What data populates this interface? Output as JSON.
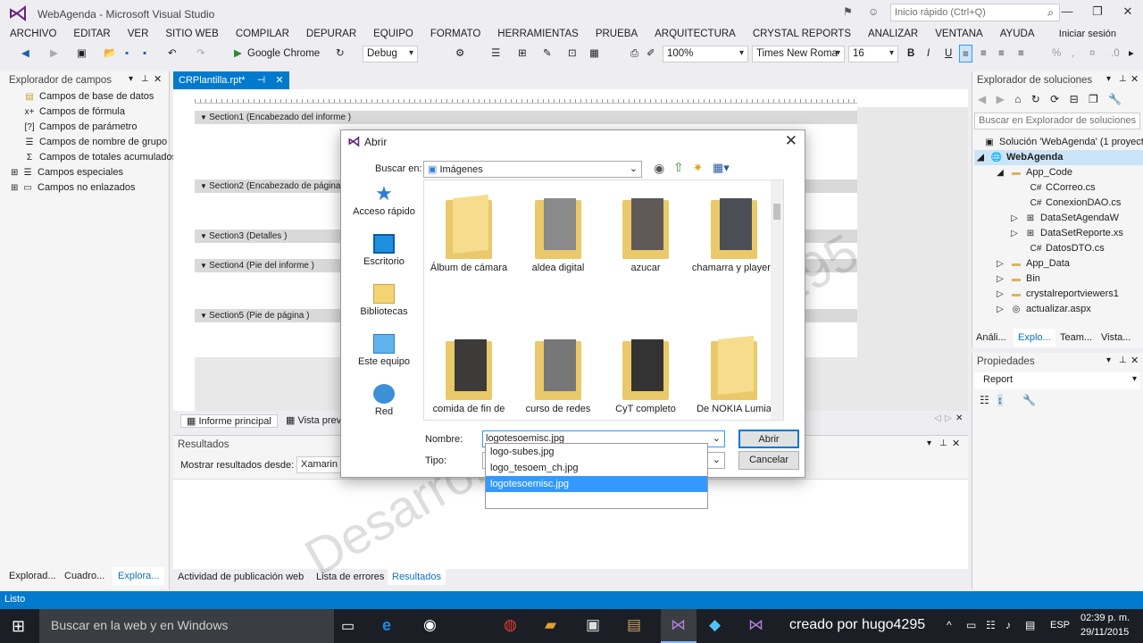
{
  "window": {
    "title": "WebAgenda - Microsoft Visual Studio",
    "quick_launch_placeholder": "Inicio rápido (Ctrl+Q)",
    "signin": "Iniciar sesión"
  },
  "menu": [
    "ARCHIVO",
    "EDITAR",
    "VER",
    "SITIO WEB",
    "COMPILAR",
    "DEPURAR",
    "EQUIPO",
    "FORMATO",
    "HERRAMIENTAS",
    "PRUEBA",
    "ARQUITECTURA",
    "CRYSTAL REPORTS",
    "ANALIZAR",
    "VENTANA",
    "AYUDA"
  ],
  "toolbar": {
    "browser": "Google Chrome",
    "config": "Debug",
    "zoom": "100%",
    "font": "Times New Roma",
    "font_size": "16"
  },
  "field_explorer": {
    "title": "Explorador de campos",
    "items": [
      "Campos de base de datos",
      "Campos de fórmula",
      "Campos de parámetro",
      "Campos de nombre de grupo",
      "Campos de totales acumulados",
      "Campos especiales",
      "Campos no enlazados"
    ],
    "icons": [
      "database-icon",
      "formula-icon",
      "parameter-icon",
      "group-name-icon",
      "running-total-icon",
      "special-fields-icon",
      "unbound-fields-icon"
    ],
    "bottom_tabs": [
      "Explorad...",
      "Cuadro...",
      "Explora..."
    ]
  },
  "document": {
    "tab": "CRPlantilla.rpt*",
    "sections": [
      "Section1 (Encabezado del informe )",
      "Section2 (Encabezado de página )",
      "Section3 (Detalles )",
      "Section4 (Pie del informe )",
      "Section5 (Pie de página )"
    ],
    "report_tabs": [
      "Informe principal",
      "Vista previa"
    ]
  },
  "results": {
    "title": "Resultados",
    "show_label": "Mostrar resultados desde:",
    "source": "Xamarin"
  },
  "output_tabs": [
    "Actividad de publicación web",
    "Lista de errores",
    "Resultados"
  ],
  "solution_explorer": {
    "title": "Explorador de soluciones",
    "search_placeholder": "Buscar en Explorador de soluciones",
    "items": [
      "Solución 'WebAgenda' (1 proyecto)",
      "WebAgenda",
      "App_Code",
      "CCorreo.cs",
      "ConexionDAO.cs",
      "DataSetAgendaW",
      "DataSetReporte.xs",
      "DatosDTO.cs",
      "App_Data",
      "Bin",
      "crystalreportviewers1",
      "actualizar.aspx"
    ],
    "tabs": [
      "Análi...",
      "Explo...",
      "Team...",
      "Vista..."
    ]
  },
  "properties": {
    "title": "Propiedades",
    "object": "Report"
  },
  "status": "Listo",
  "dialog": {
    "title": "Abrir",
    "look_in_label": "Buscar en:",
    "look_in_value": "Imágenes",
    "places": [
      "Acceso rápido",
      "Escritorio",
      "Bibliotecas",
      "Este equipo",
      "Red"
    ],
    "folders": [
      "Álbum de cámara",
      "aldea digital",
      "azucar",
      "chamarra y playera",
      "comida de fin de",
      "curso de redes",
      "CyT completo",
      "De NOKIA Lumia"
    ],
    "name_label": "Nombre:",
    "name_value": "logotesoemisc.jpg",
    "type_label": "Tipo:",
    "open_button": "Abrir",
    "cancel_button": "Cancelar",
    "suggestions": [
      "logo-subes.jpg",
      "logo_tesoem_ch.jpg",
      "logotesoemisc.jpg"
    ]
  },
  "watermark": "Desarrollado por hugo4295",
  "taskbar": {
    "search_placeholder": "Buscar en la web y en Windows",
    "credit": "creado por hugo4295",
    "lang": "ESP",
    "time": "02:39 p. m.",
    "date": "29/11/2015"
  }
}
